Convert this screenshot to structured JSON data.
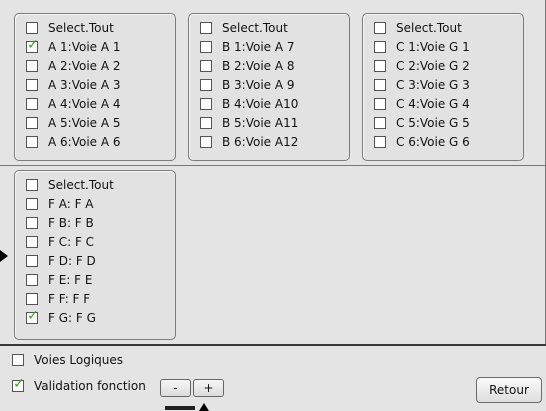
{
  "groupA": {
    "select_all": {
      "label": "Select.Tout",
      "checked": false
    },
    "items": [
      {
        "label": "A 1:Voie A 1",
        "checked": true
      },
      {
        "label": "A 2:Voie A 2",
        "checked": false
      },
      {
        "label": "A 3:Voie A 3",
        "checked": false
      },
      {
        "label": "A 4:Voie A 4",
        "checked": false
      },
      {
        "label": "A 5:Voie A 5",
        "checked": false
      },
      {
        "label": "A 6:Voie A 6",
        "checked": false
      }
    ]
  },
  "groupB": {
    "select_all": {
      "label": "Select.Tout",
      "checked": false
    },
    "items": [
      {
        "label": "B 1:Voie A 7",
        "checked": false
      },
      {
        "label": "B 2:Voie A 8",
        "checked": false
      },
      {
        "label": "B 3:Voie A 9",
        "checked": false
      },
      {
        "label": "B 4:Voie A10",
        "checked": false
      },
      {
        "label": "B 5:Voie A11",
        "checked": false
      },
      {
        "label": "B 6:Voie A12",
        "checked": false
      }
    ]
  },
  "groupC": {
    "select_all": {
      "label": "Select.Tout",
      "checked": false
    },
    "items": [
      {
        "label": "C 1:Voie G 1",
        "checked": false
      },
      {
        "label": "C 2:Voie G 2",
        "checked": false
      },
      {
        "label": "C 3:Voie G 3",
        "checked": false
      },
      {
        "label": "C 4:Voie G 4",
        "checked": false
      },
      {
        "label": "C 5:Voie G 5",
        "checked": false
      },
      {
        "label": "C 6:Voie G 6",
        "checked": false
      }
    ]
  },
  "groupF": {
    "select_all": {
      "label": "Select.Tout",
      "checked": false
    },
    "items": [
      {
        "label": "F A: F A",
        "checked": false
      },
      {
        "label": "F B: F B",
        "checked": false
      },
      {
        "label": "F C: F C",
        "checked": false
      },
      {
        "label": "F D: F D",
        "checked": false
      },
      {
        "label": "F E: F E",
        "checked": false
      },
      {
        "label": "F F: F F",
        "checked": false
      },
      {
        "label": "F G: F G",
        "checked": true
      }
    ]
  },
  "bottom": {
    "voies_logiques": {
      "label": "Voies Logiques",
      "checked": false
    },
    "validation_fonction": {
      "label": "Validation fonction",
      "checked": true
    },
    "minus_label": "-",
    "plus_label": "+",
    "retour_label": "Retour"
  },
  "check_glyph": "✓",
  "colors": {
    "check": "#3aa51d",
    "background": "#e4e4e4",
    "group_border": "#7c7c7c"
  }
}
